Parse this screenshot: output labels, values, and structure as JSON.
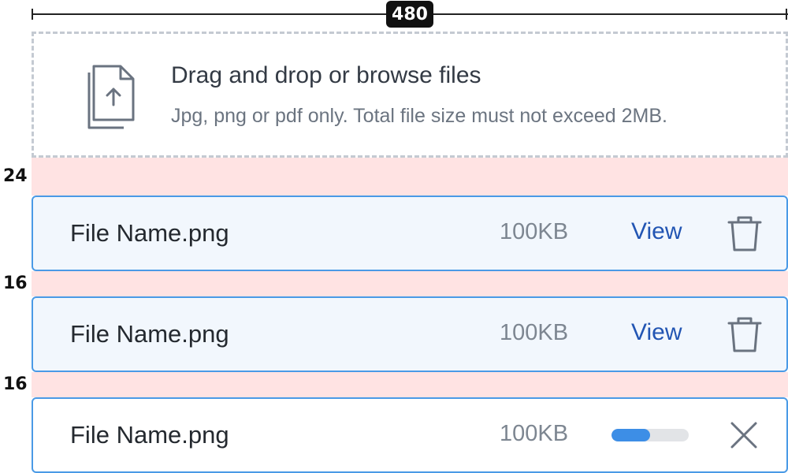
{
  "annotations": {
    "width_label": "480",
    "gap_top_label": "24",
    "gap_middle_label": "16",
    "gap_bottom_label": "16"
  },
  "dropzone": {
    "icon": "upload-file-icon",
    "title": "Drag and drop or browse files",
    "subtitle": "Jpg, png or pdf only. Total file size must not exceed 2MB."
  },
  "files": [
    {
      "name": "File Name.png",
      "size": "100KB",
      "action_label": "View",
      "status": "uploaded",
      "action_icon": "trash-icon"
    },
    {
      "name": "File Name.png",
      "size": "100KB",
      "action_label": "View",
      "status": "uploaded",
      "action_icon": "trash-icon"
    },
    {
      "name": "File Name.png",
      "size": "100KB",
      "status": "uploading",
      "progress": 0.5,
      "action_icon": "close-icon"
    }
  ],
  "colors": {
    "border": "#4a9ae6",
    "link": "#2255b3",
    "progress": "#3d8ee6",
    "spacing_highlight": "#ffe3e3"
  }
}
